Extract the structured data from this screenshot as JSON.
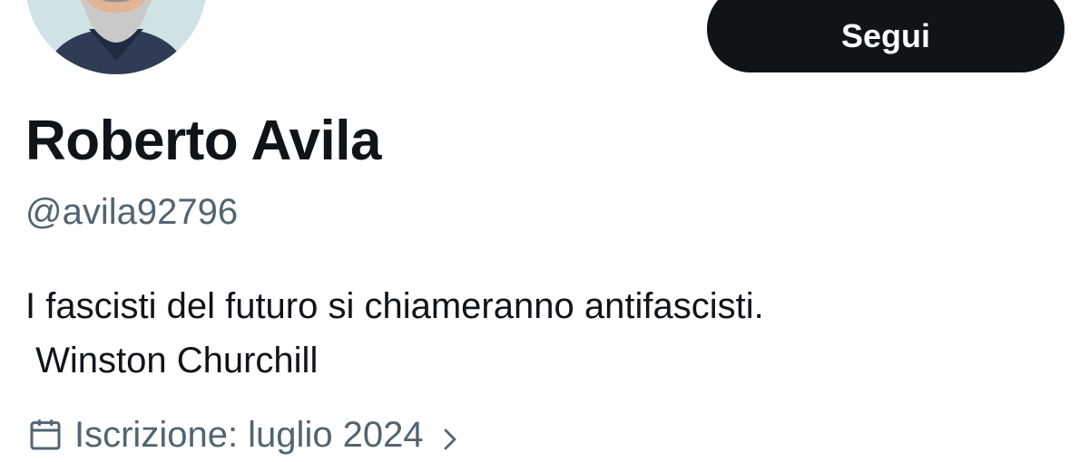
{
  "profile": {
    "name": "Roberto Avila",
    "handle": "@avila92796",
    "bio": "I fascisti del futuro si chiameranno antifascisti.\n Winston Churchill",
    "joined": "Iscrizione: luglio 2024"
  },
  "actions": {
    "follow_label": "Segui"
  },
  "icons": {
    "avatar": "avatar",
    "joined_icon": "calendar-icon",
    "joined_chevron": "chevron-right-icon"
  },
  "colors": {
    "text_primary": "#0f1419",
    "text_secondary": "#536471",
    "button_bg": "#0f1419",
    "button_text": "#ffffff"
  }
}
